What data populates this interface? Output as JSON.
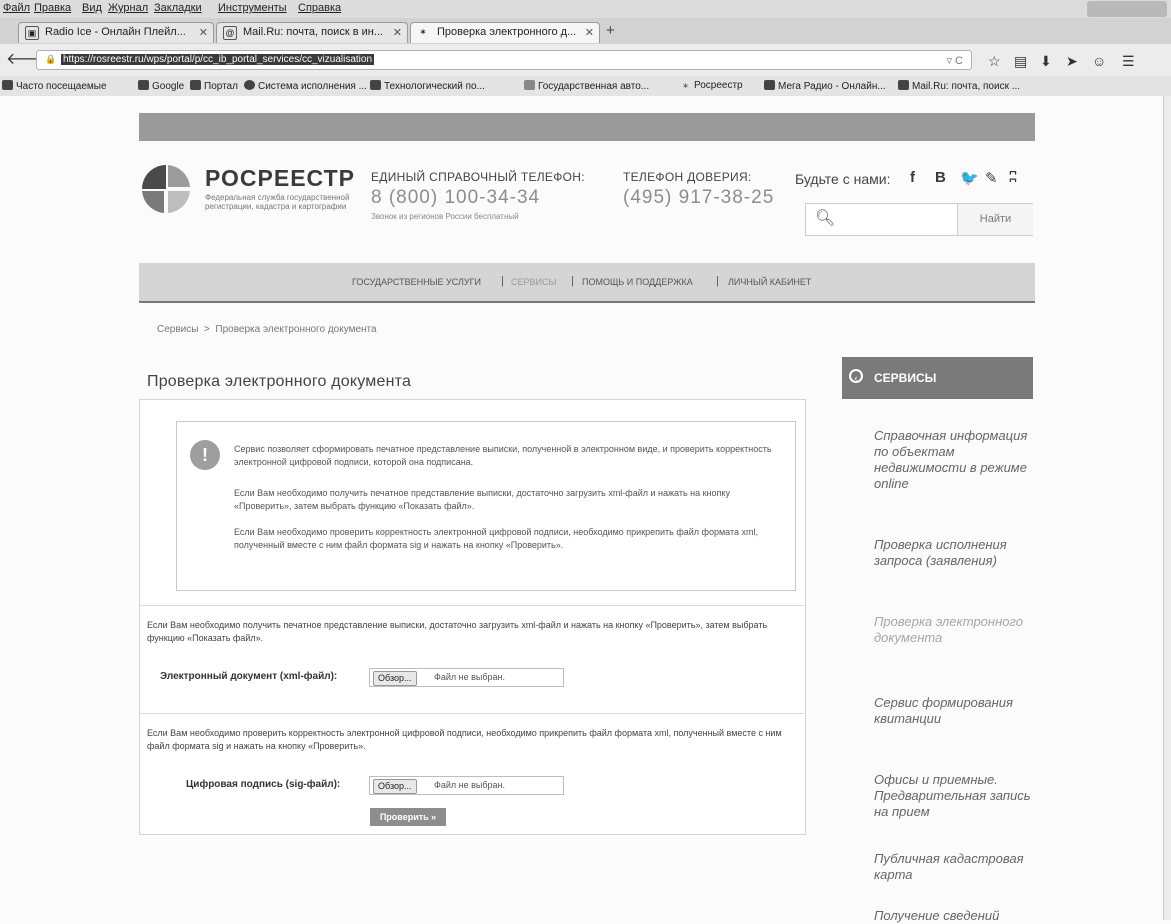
{
  "browser": {
    "menu": [
      "Файл",
      "Правка",
      "Вид",
      "Журнал",
      "Закладки",
      "Инструменты",
      "Справка"
    ],
    "tabs": [
      {
        "title": "Radio Ice - Онлайн Плейл...",
        "icon": "radio-icon"
      },
      {
        "title": "Mail.Ru: почта, поиск в ин...",
        "icon": "mail-icon"
      },
      {
        "title": "Проверка электронного д...",
        "icon": "rosreestr-icon",
        "active": true
      }
    ],
    "new_tab": "+",
    "url": "https://rosreestr.ru/wps/portal/p/cc_ib_portal_services/cc_vizualisation",
    "bookmarks": [
      "Часто посещаемые",
      "Google",
      "Портал",
      "Система исполнения ...",
      "Технологический по...",
      "Государственная авто...",
      "Росреестр",
      "Мега Радио - Онлайн...",
      "Mail.Ru: почта, поиск ..."
    ]
  },
  "header": {
    "logo_name": "РОСРЕЕСТР",
    "logo_subtitle": "Федеральная служба государственной регистрации, кадастра и картографии",
    "phone_label": "ЕДИНЫЙ СПРАВОЧНЫЙ ТЕЛЕФОН:",
    "phone": "8 (800) 100-34-34",
    "phone_note": "Звонок из регионов России бесплатный",
    "trust_label": "ТЕЛЕФОН ДОВЕРИЯ:",
    "trust_phone": "(495) 917-38-25",
    "social_label": "Будьте с нами:",
    "social": [
      "f",
      "B",
      "t",
      "o",
      "rss"
    ],
    "search_placeholder": "",
    "search_button": "Найти"
  },
  "nav": {
    "items": [
      "ГОСУДАРСТВЕННЫЕ УСЛУГИ",
      "СЕРВИСЫ",
      "ПОМОЩЬ И ПОДДЕРЖКА",
      "ЛИЧНЫЙ КАБИНЕТ"
    ],
    "separator": "|"
  },
  "breadcrumb": {
    "root": "Сервисы",
    "sep": ">",
    "current": "Проверка электронного документа"
  },
  "main": {
    "title": "Проверка электронного документа",
    "info": [
      "Сервис позволяет сформировать печатное представление выписки, полученной в электронном виде, и проверить корректность электронной цифровой подписи, которой она подписана.",
      "Если Вам необходимо получить печатное представление выписки, достаточно загрузить xml-файл и нажать на кнопку «Проверить», затем выбрать функцию «Показать файл».",
      "Если Вам необходимо проверить корректность электронной цифровой подписи, необходимо прикрепить файл формата xml, полученный вместе с ним файл формата sig и нажать на кнопку «Проверить»."
    ],
    "xml_text": "Если Вам необходимо получить печатное представление выписки, достаточно загрузить xml-файл и нажать на кнопку «Проверить», затем выбрать функцию «Показать файл».",
    "xml_label": "Электронный документ (xml-файл):",
    "sig_text": "Если Вам необходимо проверить корректность электронной цифровой подписи, необходимо прикрепить файл формата xml, полученный вместе с ним файл формата sig и нажать на кнопку «Проверить».",
    "sig_label": "Цифровая подпись (sig-файл):",
    "browse": "Обзор...",
    "no_file": "Файл не выбран.",
    "check_button": "Проверить »"
  },
  "sidebar": {
    "header": "СЕРВИСЫ",
    "items": [
      "Справочная информация по объектам недвижимости в режиме online",
      "Проверка исполнения запроса (заявления)",
      "Проверка электронного документа",
      "Сервис формирования квитанции",
      "Офисы и приемные. Предварительная запись на прием",
      "Публичная кадастровая карта",
      "Получение сведений"
    ]
  }
}
